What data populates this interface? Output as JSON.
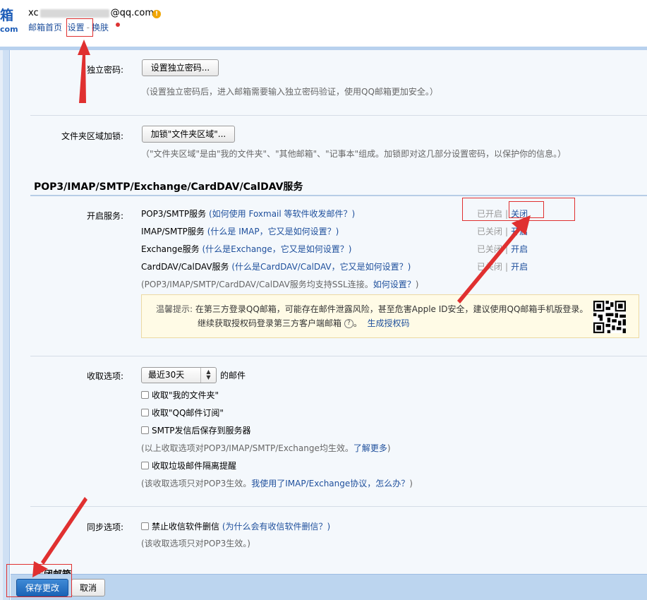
{
  "header": {
    "logo_char": "箱",
    "logo_com": "com",
    "email_prefix": "xc",
    "email_suffix": "@qq.com>",
    "warn_icon": "!",
    "nav": {
      "home": "邮箱首页",
      "settings": "设置",
      "sep": "-",
      "skin": "换肤"
    }
  },
  "password": {
    "label": "独立密码:",
    "button": "设置独立密码...",
    "hint": "（设置独立密码后，进入邮箱需要输入独立密码验证，使用QQ邮箱更加安全。）"
  },
  "folder_lock": {
    "label": "文件夹区域加锁:",
    "button": "加锁\"文件夹区域\"...",
    "hint": "（\"文件夹区域\"是由\"我的文件夹\"、\"其他邮箱\"、\"记事本\"组成。加锁即对这几部分设置密码，以保护你的信息。）"
  },
  "services": {
    "title": "POP3/IMAP/SMTP/Exchange/CardDAV/CalDAV服务",
    "label": "开启服务:",
    "items": [
      {
        "name": "POP3/SMTP服务",
        "help": "(如何使用 Foxmail 等软件收发邮件？)",
        "status": "已开启",
        "sep": "|",
        "action": "关闭"
      },
      {
        "name": "IMAP/SMTP服务",
        "help": "(什么是 IMAP，它又是如何设置？)",
        "status": "已关闭",
        "sep": "|",
        "action": "开启"
      },
      {
        "name": "Exchange服务",
        "help": "(什么是Exchange，它又是如何设置？)",
        "status": "已关闭",
        "sep": "|",
        "action": "开启"
      },
      {
        "name": "CardDAV/CalDAV服务",
        "help": "(什么是CardDAV/CalDAV，它又是如何设置？)",
        "status": "已关闭",
        "sep": "|",
        "action": "开启"
      }
    ],
    "ssl_hint_a": "(POP3/IMAP/SMTP/CardDAV/CalDAV服务均支持SSL连接。",
    "ssl_hint_link": "如何设置？",
    "ssl_hint_b": ")"
  },
  "tip": {
    "prefix": "温馨提示:",
    "line1": "在第三方登录QQ邮箱，可能存在邮件泄露风险，甚至危害Apple ID安全，建议使用QQ邮箱手机版登录。",
    "line2": "继续获取授权码登录第三方客户端邮箱",
    "help_icon": "?",
    "line2_end": "。",
    "link": "生成授权码"
  },
  "receive": {
    "label": "收取选项:",
    "select_value": "最近30天",
    "select_suffix": "的邮件",
    "options": [
      "收取\"我的文件夹\"",
      "收取\"QQ邮件订阅\"",
      "SMTP发信后保存到服务器"
    ],
    "hint1_a": "(以上收取选项对POP3/IMAP/SMTP/Exchange均生效。",
    "hint1_link": "了解更多",
    "hint1_b": ")",
    "spam_option": "收取垃圾邮件隔离提醒",
    "hint2_a": "(该收取选项只对POP3生效。",
    "hint2_link": "我使用了IMAP/Exchange协议，怎么办？",
    "hint2_b": ")"
  },
  "sync": {
    "label": "同步选项:",
    "option": "禁止收信软件删信",
    "option_help": "(为什么会有收信软件删信？)",
    "hint": "(该收取选项只对POP3生效。)"
  },
  "peek_section": "关闭邮箱",
  "footer": {
    "save": "保存更改",
    "cancel": "取消"
  },
  "colors": {
    "link": "#1e4f9c",
    "annotation": "#e03030",
    "save_button": "#2a74c6",
    "bottom_bar": "#bcd5ef"
  }
}
